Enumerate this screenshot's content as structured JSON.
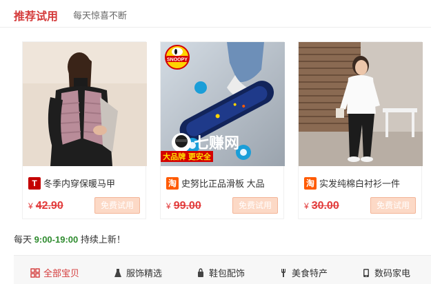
{
  "header": {
    "title": "推荐试用",
    "subtitle": "每天惊喜不断"
  },
  "products": [
    {
      "name": "冬季内穿保暖马甲",
      "shop_type": "tmall",
      "badge": "T",
      "currency": "¥",
      "price": "42.90",
      "button": "免费试用"
    },
    {
      "name": "史努比正品滑板 大品",
      "shop_type": "taobao",
      "badge": "淘",
      "currency": "¥",
      "price": "99.00",
      "button": "免费试用",
      "image_text": {
        "logo": "SNOOPY",
        "watermark": "七赚网",
        "banner": "大品牌 更安全"
      }
    },
    {
      "name": "实发纯棉白衬衫一件",
      "shop_type": "taobao",
      "badge": "淘",
      "currency": "¥",
      "price": "30.00",
      "button": "免费试用"
    }
  ],
  "promo": {
    "prefix": "每天",
    "hours": "9:00-19:00",
    "suffix": "持续上新！"
  },
  "categories": [
    {
      "label": "全部宝贝",
      "icon": "grid-icon",
      "active": true
    },
    {
      "label": "服饰精选",
      "icon": "dress-icon",
      "active": false
    },
    {
      "label": "鞋包配饰",
      "icon": "bag-icon",
      "active": false
    },
    {
      "label": "美食特产",
      "icon": "food-icon",
      "active": false
    },
    {
      "label": "数码家电",
      "icon": "phone-icon",
      "active": false
    }
  ],
  "colors": {
    "accent": "#d43a3a",
    "promo_highlight": "#2e8b2e",
    "button_bg": "#fcd9c6"
  }
}
